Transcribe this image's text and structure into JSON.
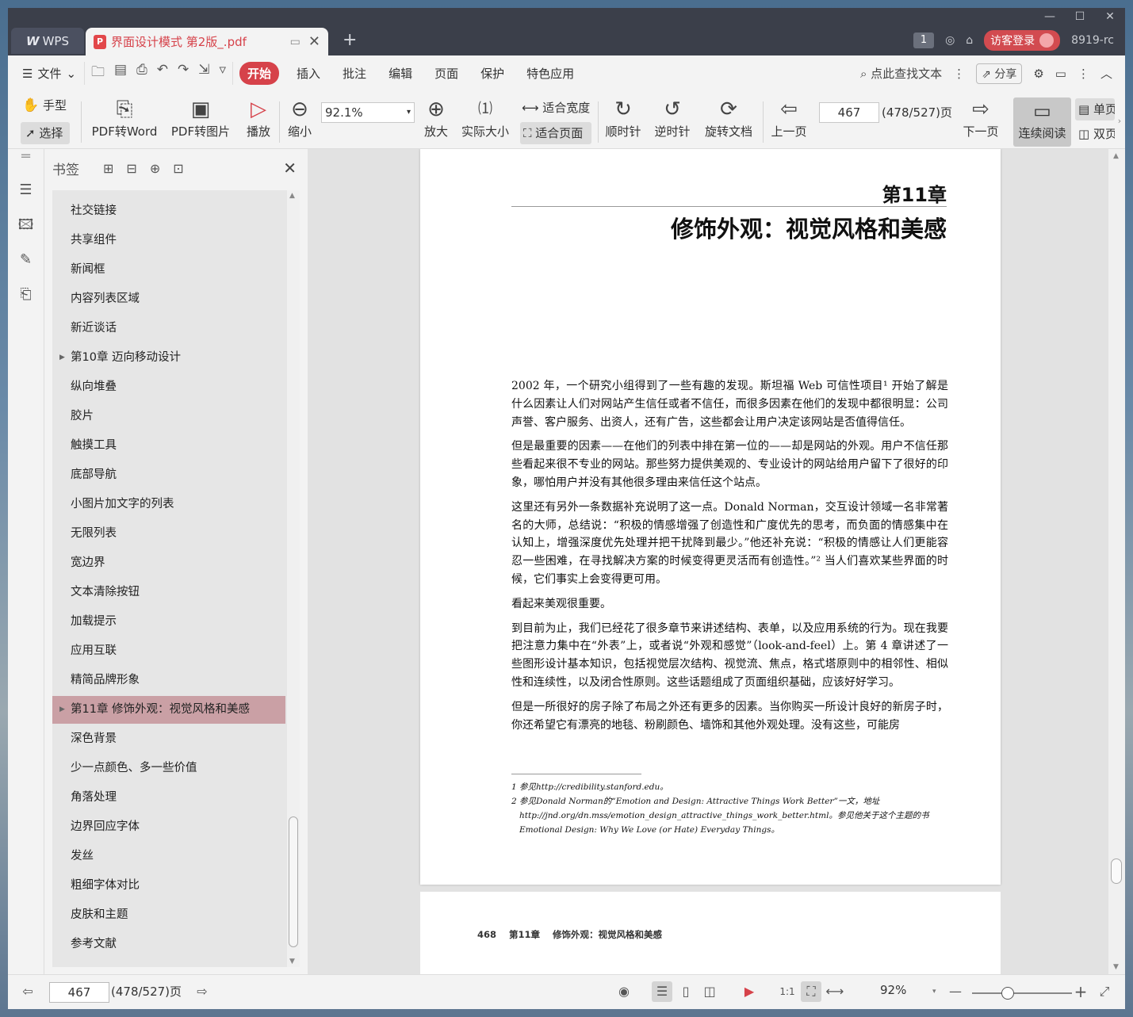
{
  "titlebar": {
    "wps_label": "WPS",
    "doc_tab_title": "界面设计模式 第2版_.pdf",
    "page_badge": "1",
    "login_label": "访客登录",
    "user_id": "8919-rc"
  },
  "menubar": {
    "file_label": "文件",
    "tabs": [
      "开始",
      "插入",
      "批注",
      "编辑",
      "页面",
      "保护",
      "特色应用"
    ],
    "search_label": "点此查找文本",
    "share_label": "分享"
  },
  "toolbar": {
    "hand": "手型",
    "select": "选择",
    "pdf_to_word": "PDF转Word",
    "pdf_to_image": "PDF转图片",
    "play": "播放",
    "zoom_out": "缩小",
    "zoom_value": "92.1%",
    "zoom_in": "放大",
    "actual_size": "实际大小",
    "fit_width": "适合宽度",
    "fit_page": "适合页面",
    "rotate_cw": "顺时针",
    "rotate_ccw": "逆时针",
    "rotate_doc": "旋转文档",
    "prev_page": "上一页",
    "page_value": "467",
    "page_total": "(478/527)页",
    "next_page": "下一页",
    "continuous": "连续阅读",
    "single": "单页",
    "double": "双页"
  },
  "bookmarks": {
    "title": "书签",
    "items": [
      {
        "label": "社交链接",
        "arrow": false,
        "active": false
      },
      {
        "label": "共享组件",
        "arrow": false,
        "active": false
      },
      {
        "label": "新闻框",
        "arrow": false,
        "active": false
      },
      {
        "label": "内容列表区域",
        "arrow": false,
        "active": false
      },
      {
        "label": "新近谈话",
        "arrow": false,
        "active": false
      },
      {
        "label": "第10章 迈向移动设计",
        "arrow": true,
        "active": false
      },
      {
        "label": "纵向堆叠",
        "arrow": false,
        "active": false
      },
      {
        "label": "胶片",
        "arrow": false,
        "active": false
      },
      {
        "label": "触摸工具",
        "arrow": false,
        "active": false
      },
      {
        "label": "底部导航",
        "arrow": false,
        "active": false
      },
      {
        "label": "小图片加文字的列表",
        "arrow": false,
        "active": false
      },
      {
        "label": "无限列表",
        "arrow": false,
        "active": false
      },
      {
        "label": "宽边界",
        "arrow": false,
        "active": false
      },
      {
        "label": "文本清除按钮",
        "arrow": false,
        "active": false
      },
      {
        "label": "加载提示",
        "arrow": false,
        "active": false
      },
      {
        "label": "应用互联",
        "arrow": false,
        "active": false
      },
      {
        "label": "精简品牌形象",
        "arrow": false,
        "active": false
      },
      {
        "label": "第11章 修饰外观：视觉风格和美感",
        "arrow": true,
        "active": true
      },
      {
        "label": "深色背景",
        "arrow": false,
        "active": false
      },
      {
        "label": "少一点颜色、多一些价值",
        "arrow": false,
        "active": false
      },
      {
        "label": "角落处理",
        "arrow": false,
        "active": false
      },
      {
        "label": "边界回应字体",
        "arrow": false,
        "active": false
      },
      {
        "label": "发丝",
        "arrow": false,
        "active": false
      },
      {
        "label": "粗细字体对比",
        "arrow": false,
        "active": false
      },
      {
        "label": "皮肤和主题",
        "arrow": false,
        "active": false
      },
      {
        "label": "参考文献",
        "arrow": false,
        "active": false
      }
    ]
  },
  "document": {
    "chapter_number": "第11章",
    "chapter_title": "修饰外观：视觉风格和美感",
    "paragraphs": [
      "2002 年，一个研究小组得到了一些有趣的发现。斯坦福 Web 可信性项目¹ 开始了解是什么因素让人们对网站产生信任或者不信任，而很多因素在他们的发现中都很明显：公司声誉、客户服务、出资人，还有广告，这些都会让用户决定该网站是否值得信任。",
      "但是最重要的因素——在他们的列表中排在第一位的——却是网站的外观。用户不信任那些看起来很不专业的网站。那些努力提供美观的、专业设计的网站给用户留下了很好的印象，哪怕用户并没有其他很多理由来信任这个站点。",
      "这里还有另外一条数据补充说明了这一点。Donald Norman，交互设计领域一名非常著名的大师，总结说：“积极的情感增强了创造性和广度优先的思考，而负面的情感集中在认知上，增强深度优先处理并把干扰降到最少。”他还补充说：“积极的情感让人们更能容忍一些困难，在寻找解决方案的时候变得更灵活而有创造性。”² 当人们喜欢某些界面的时候，它们事实上会变得更可用。",
      "看起来美观很重要。",
      "到目前为止，我们已经花了很多章节来讲述结构、表单，以及应用系统的行为。现在我要把注意力集中在“外表”上，或者说“外观和感觉”（look-and-feel）上。第 4 章讲述了一些图形设计基本知识，包括视觉层次结构、视觉流、焦点，格式塔原则中的相邻性、相似性和连续性，以及闭合性原则。这些话题组成了页面组织基础，应该好好学习。",
      "但是一所很好的房子除了布局之外还有更多的因素。当你购买一所设计良好的新房子时，你还希望它有漂亮的地毯、粉刷颜色、墙饰和其他外观处理。没有这些，可能房"
    ],
    "footnotes": [
      "1  参见http://credibility.stanford.edu。",
      "2  参见Donald Norman的“Emotion and Design: Attractive Things Work Better”一文，地址http://jnd.org/dn.mss/emotion_design_attractive_things_work_better.html。参见他关于这个主题的书Emotional Design: Why We Love (or Hate) Everyday Things。"
    ],
    "next_page_header": "468    第11章    修饰外观：视觉风格和美感"
  },
  "statusbar": {
    "page_value": "467",
    "page_total": "(478/527)页",
    "zoom_value": "92%",
    "zoom_level_fraction": 0.36
  }
}
